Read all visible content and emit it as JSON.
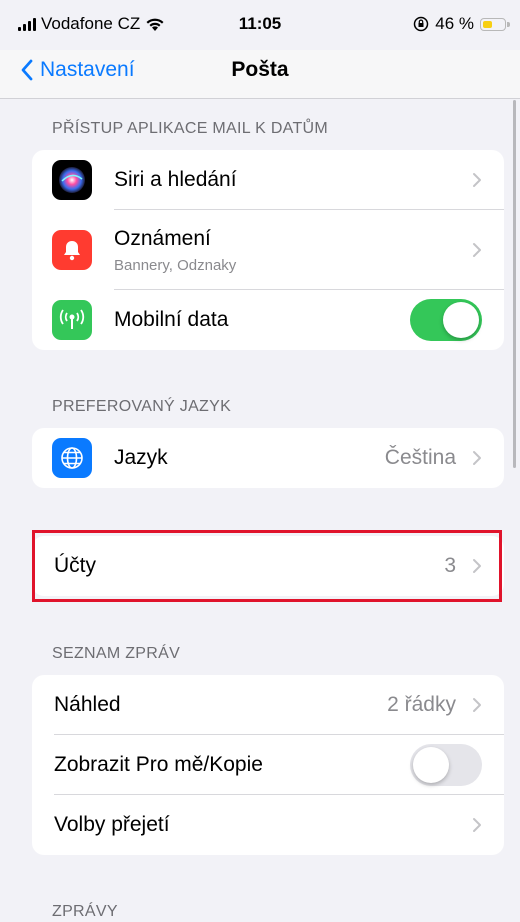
{
  "status_bar": {
    "carrier": "Vodafone CZ",
    "time": "11:05",
    "battery_percent": "46 %",
    "battery_level": 0.46
  },
  "nav": {
    "back_label": "Nastavení",
    "title": "Pošta"
  },
  "section_access": {
    "header": "PŘÍSTUP APLIKACE MAIL K DATŮM",
    "items": [
      {
        "label": "Siri a hledání",
        "icon": "siri-icon"
      },
      {
        "label": "Oznámení",
        "sublabel": "Bannery, Odznaky",
        "icon": "notifications-icon"
      },
      {
        "label": "Mobilní data",
        "icon": "cellular-icon",
        "toggle": true
      }
    ]
  },
  "section_language": {
    "header": "PREFEROVANÝ JAZYK",
    "items": [
      {
        "label": "Jazyk",
        "value": "Čeština",
        "icon": "globe-icon"
      }
    ]
  },
  "section_accounts": {
    "items": [
      {
        "label": "Účty",
        "value": "3"
      }
    ]
  },
  "section_messages": {
    "header": "SEZNAM ZPRÁV",
    "items": [
      {
        "label": "Náhled",
        "value": "2 řádky"
      },
      {
        "label": "Zobrazit Pro mě/Kopie",
        "toggle": false
      },
      {
        "label": "Volby přejetí"
      }
    ]
  },
  "section_zpravy": {
    "header": "ZPRÁVY"
  },
  "colors": {
    "accent": "#0a7aff",
    "toggle_on": "#34c759",
    "highlight": "#e0132b"
  }
}
